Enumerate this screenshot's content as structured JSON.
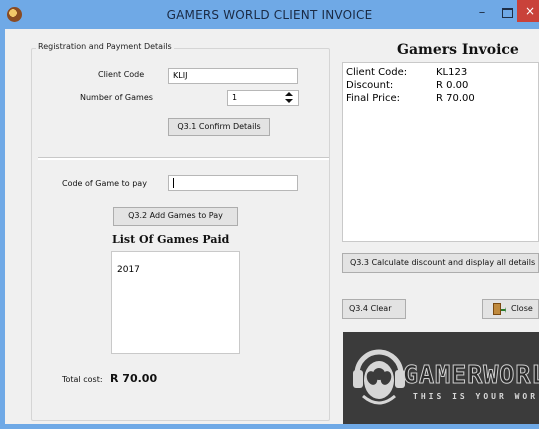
{
  "window": {
    "title": "GAMERS WORLD CLIENT INVOICE",
    "min_glyph": "–",
    "close_glyph": "×"
  },
  "registration": {
    "caption": "Registration and Payment Details",
    "client_code_label": "Client Code",
    "client_code_value": "KLIJ",
    "number_of_games_label": "Number of Games",
    "number_of_games_value": "1",
    "confirm_button": "Q3.1 Confirm Details",
    "code_to_pay_label": "Code of Game to pay",
    "code_to_pay_value": "",
    "add_games_button": "Q3.2 Add Games to Pay",
    "list_heading": "List Of Games Paid",
    "games_paid": [
      "2017"
    ],
    "total_cost_label": "Total cost:",
    "total_cost_value": "R 70.00"
  },
  "invoice": {
    "heading": "Gamers Invoice",
    "lines": [
      {
        "label": "Client Code:",
        "value": "KL123"
      },
      {
        "label": "Discount:",
        "value": "R 0.00"
      },
      {
        "label": "Final Price:",
        "value": "R 70.00"
      }
    ],
    "calculate_button": "Q3.3 Calculate discount and display all details",
    "clear_button": "Q3.4 Clear",
    "close_button": "Close"
  },
  "logo": {
    "wordmark": "GAMERWORLD",
    "tagline": "THIS IS YOUR WORLD"
  }
}
